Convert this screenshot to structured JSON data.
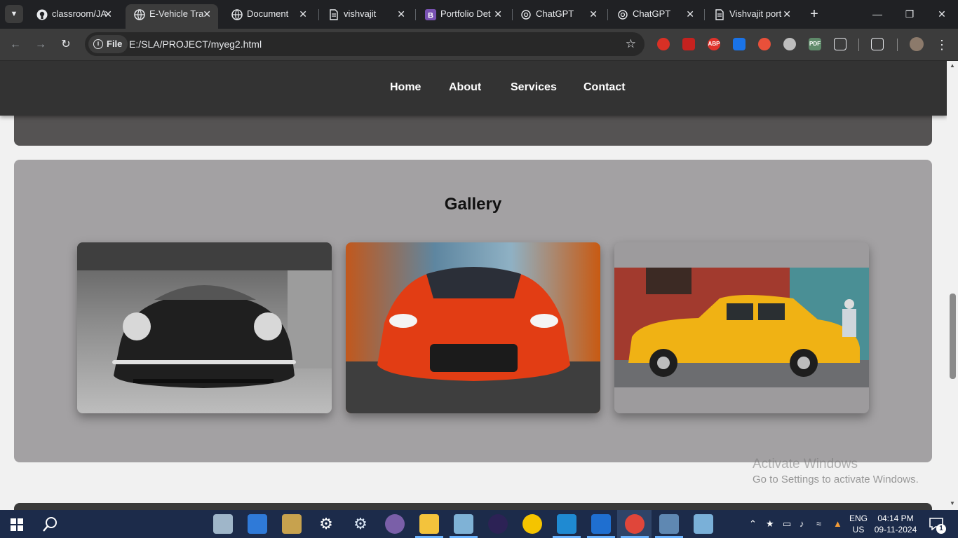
{
  "browser": {
    "tabs": [
      {
        "title": "classroom/JA",
        "icon": "github-icon"
      },
      {
        "title": "E-Vehicle Tra",
        "icon": "globe-icon",
        "active": true
      },
      {
        "title": "Document",
        "icon": "globe-icon"
      },
      {
        "title": "vishvajit",
        "icon": "page-icon"
      },
      {
        "title": "Portfolio Det",
        "icon": "bootstrap-icon"
      },
      {
        "title": "ChatGPT",
        "icon": "chatgpt-icon"
      },
      {
        "title": "ChatGPT",
        "icon": "chatgpt-icon"
      },
      {
        "title": "Vishvajit port",
        "icon": "page-icon"
      }
    ],
    "close_glyph": "✕",
    "new_tab_glyph": "+",
    "omnibox": {
      "scheme_label": "File",
      "url": "E:/SLA/PROJECT/myeg2.html"
    },
    "extensions": [
      {
        "name": "adblock-hand-icon",
        "color": "#d93025",
        "label": ""
      },
      {
        "name": "video-ext-icon",
        "color": "#c5221f",
        "label": ""
      },
      {
        "name": "abp-icon",
        "color": "#e0322b",
        "label": "ABP"
      },
      {
        "name": "alert-ext-icon",
        "color": "#1a73e8",
        "label": ""
      },
      {
        "name": "spiral-ext-icon",
        "color": "#e8503a",
        "label": ""
      },
      {
        "name": "puzzle-cloud-icon",
        "color": "#bdbdbd",
        "label": ""
      },
      {
        "name": "pdf-ext-icon",
        "color": "#5f8a6a",
        "label": "PDF"
      }
    ]
  },
  "site": {
    "nav": [
      "Home",
      "About",
      "Services",
      "Contact"
    ],
    "gallery_title": "Gallery",
    "gallery_images": [
      {
        "name": "black-vintage-convertible-image"
      },
      {
        "name": "red-sports-car-image"
      },
      {
        "name": "yellow-classic-taxi-image"
      }
    ]
  },
  "watermark": {
    "title": "Activate Windows",
    "subtitle": "Go to Settings to activate Windows."
  },
  "taskbar": {
    "language": "ENG",
    "region": "US",
    "time": "04:14 PM",
    "date": "09-11-2024",
    "notifications": "1"
  }
}
